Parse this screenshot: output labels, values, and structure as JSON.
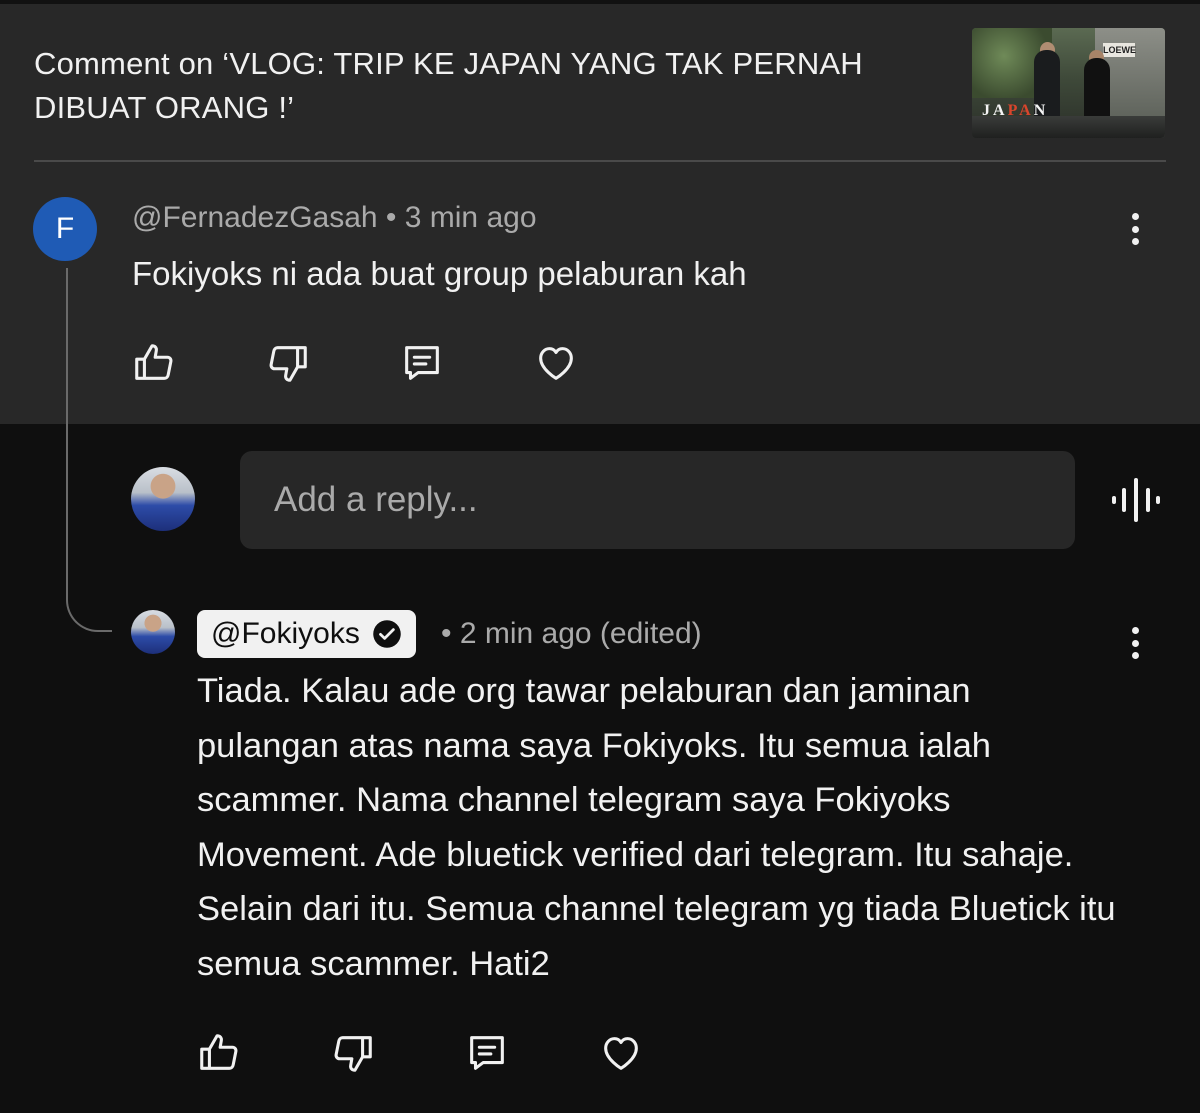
{
  "header": {
    "title": "Comment on ‘VLOG: TRIP KE JAPAN YANG TAK PERNAH DIBUAT ORANG !’",
    "thumbnail_text_left": "JA",
    "thumbnail_text_accent": "PA",
    "thumbnail_text_right": "N",
    "thumbnail_sign": "LOEWE"
  },
  "parent_comment": {
    "avatar_letter": "F",
    "meta": "@FernadezGasah • 3 min ago",
    "text": "Fokiyoks ni ada buat group pelaburan kah"
  },
  "reply_box": {
    "placeholder": "Add a reply..."
  },
  "reply_comment": {
    "author": "@Fokiyoks",
    "meta": "• 2 min ago (edited)",
    "text": "Tiada. Kalau ade org tawar pelaburan dan jaminan pulangan atas nama saya Fokiyoks. Itu semua ialah scammer. Nama channel telegram saya Fokiyoks Movement. Ade bluetick verified dari telegram. Itu sahaje. Selain dari itu. Semua channel telegram yg tiada Bluetick itu semua scammer. Hati2"
  },
  "icons": {
    "like": "thumbs-up-icon",
    "dislike": "thumbs-down-icon",
    "reply": "comment-icon",
    "heart": "heart-icon",
    "more": "more-vertical-icon",
    "voice": "voice-icon",
    "verified": "verified-check-icon"
  },
  "colors": {
    "panel": "#282828",
    "background": "#0f0f0f",
    "avatar_blue": "#1f5bb5",
    "secondary_text": "#aaaaaa"
  }
}
